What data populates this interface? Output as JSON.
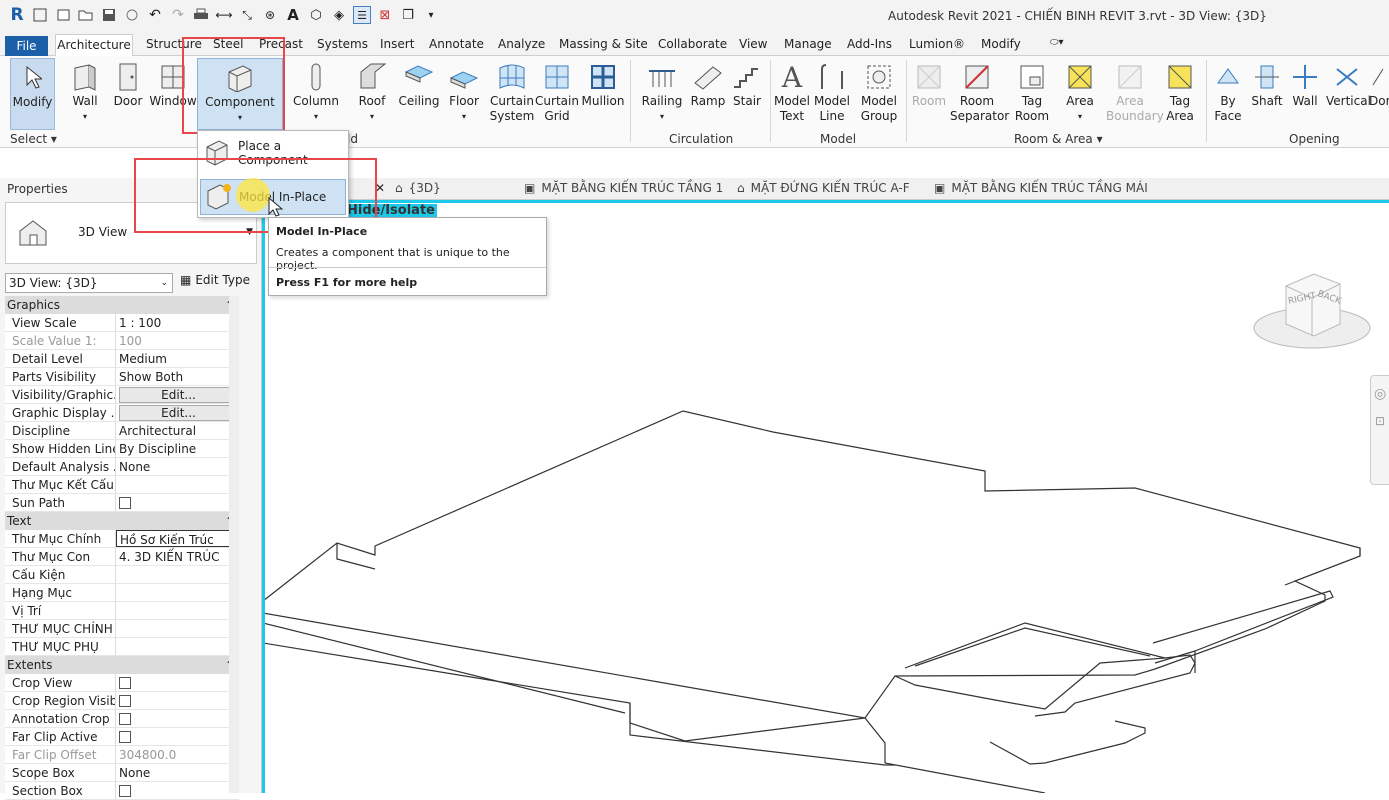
{
  "app_title": "Autodesk Revit 2021 - CHIẾN BINH REVIT 3.rvt - 3D View: {3D}",
  "menu_tabs": [
    "File",
    "Architecture",
    "Structure",
    "Steel",
    "Precast",
    "Systems",
    "Insert",
    "Annotate",
    "Analyze",
    "Massing & Site",
    "Collaborate",
    "View",
    "Manage",
    "Add-Ins",
    "Lumion®",
    "Modify"
  ],
  "ribbon": {
    "modify": "Modify",
    "select": "Select",
    "wall": "Wall",
    "door": "Door",
    "window": "Window",
    "component": "Component",
    "column": "Column",
    "roof": "Roof",
    "ceiling": "Ceiling",
    "floor": "Floor",
    "curtain_system_1": "Curtain",
    "curtain_system_2": "System",
    "curtain_grid_1": "Curtain",
    "curtain_grid_2": "Grid",
    "mullion": "Mullion",
    "railing": "Railing",
    "ramp": "Ramp",
    "stair": "Stair",
    "model_text_1": "Model",
    "model_text_2": "Text",
    "model_line_1": "Model",
    "model_line_2": "Line",
    "model_group_1": "Model",
    "model_group_2": "Group",
    "room": "Room",
    "room_sep_1": "Room",
    "room_sep_2": "Separator",
    "tag_room_1": "Tag",
    "tag_room_2": "Room",
    "area": "Area",
    "area_boundary_1": "Area",
    "area_boundary_2": "Boundary",
    "tag_area_1": "Tag",
    "tag_area_2": "Area",
    "by_face_1": "By",
    "by_face_2": "Face",
    "shaft": "Shaft",
    "wall_opening": "Wall",
    "vertical": "Vertical",
    "dormer": "Dor",
    "group_build_tail": "ld",
    "group_circulation": "Circulation",
    "group_model": "Model",
    "group_room_area": "Room & Area",
    "group_opening": "Opening"
  },
  "dropdown": {
    "place_component": "Place a Component",
    "model_in_place": "Model In-Place"
  },
  "tooltip": {
    "title": "Model In-Place",
    "desc": "Creates a component that is unique to the project.",
    "help": "Press F1 for more help"
  },
  "view_tabs": [
    "{3D}",
    "MẶT BẰNG KIẾN TRÚC TẦNG 1",
    "MẶT ĐỨNG KIẾN TRÚC A-F",
    "MẶT BẰNG KIẾN TRÚC TẦNG MÁI"
  ],
  "hide_isolate": "Hide/Isolate",
  "properties": {
    "title": "Properties",
    "type_name": "3D View",
    "view_selector": "3D View: {3D}",
    "edit_type": "Edit Type",
    "sections": {
      "graphics": "Graphics",
      "text": "Text",
      "extents": "Extents"
    },
    "graphics_rows": [
      [
        "View Scale",
        "1 : 100"
      ],
      [
        "Scale Value    1:",
        "100"
      ],
      [
        "Detail Level",
        "Medium"
      ],
      [
        "Parts Visibility",
        "Show Both"
      ],
      [
        "Visibility/Graphic...",
        "Edit..."
      ],
      [
        "Graphic Display ...",
        "Edit..."
      ],
      [
        "Discipline",
        "Architectural"
      ],
      [
        "Show Hidden Lines",
        "By Discipline"
      ],
      [
        "Default Analysis ...",
        "None"
      ],
      [
        "Thư Mục Kết Cấu",
        ""
      ],
      [
        "Sun Path",
        ""
      ]
    ],
    "text_rows": [
      [
        "Thư Mục Chính",
        "Hồ Sơ Kiến Trúc"
      ],
      [
        "Thư Mục Con",
        "4. 3D KIẾN TRÚC"
      ],
      [
        "Cấu Kiện",
        ""
      ],
      [
        "Hạng Mục",
        ""
      ],
      [
        "Vị Trí",
        ""
      ],
      [
        "THƯ MỤC CHÍNH",
        ""
      ],
      [
        "THƯ MỤC PHỤ",
        ""
      ]
    ],
    "extents_rows": [
      [
        "Crop View",
        ""
      ],
      [
        "Crop Region Visible",
        ""
      ],
      [
        "Annotation Crop",
        ""
      ],
      [
        "Far Clip Active",
        ""
      ],
      [
        "Far Clip Offset",
        "304800.0"
      ],
      [
        "Scope Box",
        "None"
      ],
      [
        "Section Box",
        ""
      ]
    ]
  },
  "viewcube": {
    "right": "RIGHT",
    "back": "BACK"
  }
}
